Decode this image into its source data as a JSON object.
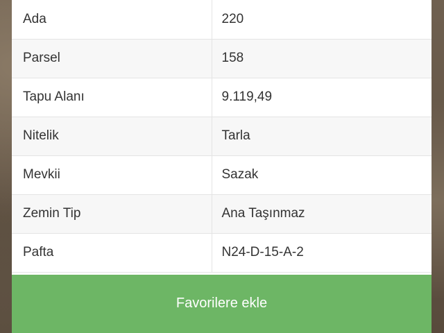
{
  "details": {
    "rows": [
      {
        "label": "Ada",
        "value": "220"
      },
      {
        "label": "Parsel",
        "value": "158"
      },
      {
        "label": "Tapu Alanı",
        "value": "9.119,49"
      },
      {
        "label": "Nitelik",
        "value": "Tarla"
      },
      {
        "label": "Mevkii",
        "value": "Sazak"
      },
      {
        "label": "Zemin Tip",
        "value": "Ana Taşınmaz"
      },
      {
        "label": "Pafta",
        "value": "N24-D-15-A-2"
      }
    ]
  },
  "actions": {
    "favorite_label": "Favorilere ekle"
  },
  "colors": {
    "button_green": "#6db665",
    "stripe": "#f7f7f7"
  }
}
